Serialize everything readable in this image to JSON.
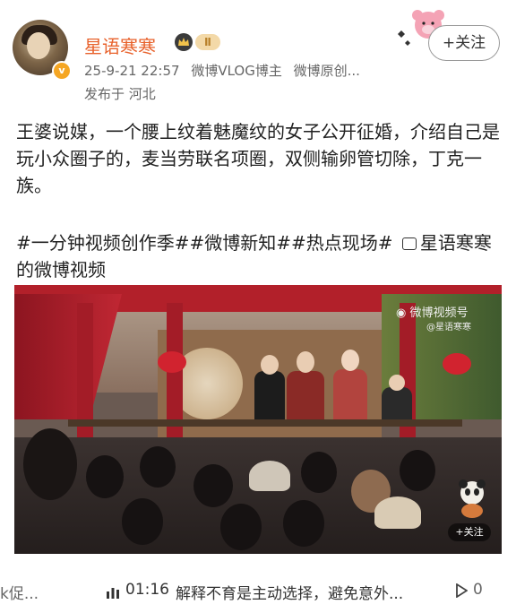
{
  "header": {
    "username": "星语寒寒",
    "level_badge": "Ⅱ",
    "verified_mark": "v",
    "post_time": "25-9-21 22:57",
    "source_tags": [
      "微博VLOG博主",
      "微博原创..."
    ],
    "location": "发布于 河北",
    "follow_label": "+关注"
  },
  "post": {
    "text": "王婆说媒，一个腰上纹着魅魔纹的女子公开征婚，介绍自己是玩小众圈子的，麦当劳联名项圈，双侧输卵管切除，丁克一族。",
    "tags_text": "#一分钟视频创作季##微博新知##热点现场#",
    "video_link_text": "星语寒寒的微博视频"
  },
  "video": {
    "watermark": "微博视频号",
    "watermark_sub": "@星语寒寒",
    "follow_label": "+关注"
  },
  "bottom_bar": {
    "prev_text": "k促...",
    "duration": "01:16",
    "next_title": "解释不育是主动选择，避免意外...",
    "next_count": "0"
  },
  "icons": {
    "avatar": "avatar",
    "crown": "crown-icon",
    "follow_bear": "strawberry-bear-sticker",
    "video_link": "video-icon",
    "weibo": "weibo-logo-icon",
    "bars": "audio-bars-icon",
    "play": "play-icon"
  },
  "colors": {
    "username": "#e8622c",
    "level_badge_bg": "#f3d9a8"
  }
}
